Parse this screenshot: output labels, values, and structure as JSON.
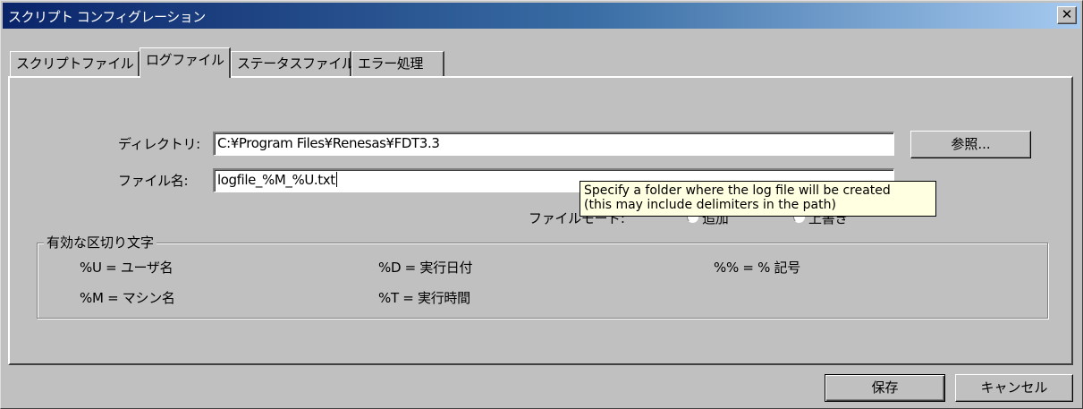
{
  "window": {
    "title": "スクリプト コンフィグレーション",
    "close_glyph": "✕"
  },
  "tabs": [
    {
      "label": "スクリプトファイル",
      "active": false
    },
    {
      "label": "ログファイル",
      "active": true
    },
    {
      "label": "ステータスファイル",
      "active": false
    },
    {
      "label": "エラー処理",
      "active": false
    }
  ],
  "log": {
    "directory_label": "ディレクトリ:",
    "directory_value": "C:¥Program Files¥Renesas¥FDT3.3",
    "browse_label": "参照...",
    "filename_label": "ファイル名:",
    "filename_value": "logfile_%M_%U.txt",
    "file_mode_label": "ファイルモード:",
    "radio_append": "追加",
    "radio_overwrite": "上書き"
  },
  "tooltip": {
    "line1": "Specify a folder where the log file will be created",
    "line2": "(this may include delimiters in the path)"
  },
  "delimiters": {
    "title": "有効な区切り文字",
    "items": [
      "%U = ユーザ名",
      "%D = 実行日付",
      "%% = % 記号",
      "%M = マシン名",
      "%T = 実行時間"
    ]
  },
  "footer": {
    "save_label": "保存",
    "cancel_label": "キャンセル"
  }
}
